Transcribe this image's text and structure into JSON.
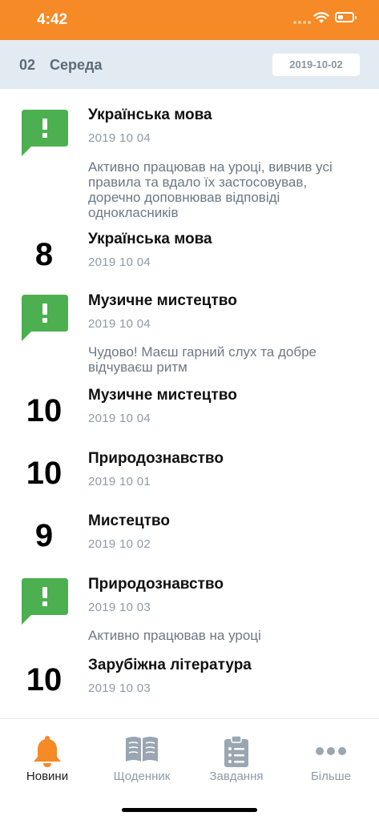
{
  "status_bar": {
    "time": "4:42",
    "background": "#f58a26"
  },
  "date_header": {
    "day_number": "02",
    "day_name": "Середа",
    "date": "2019-10-02"
  },
  "feed": {
    "items": [
      {
        "kind": "comment",
        "icon": "exclamation-bubble-icon",
        "subject": "Українська мова",
        "date": "2019 10 04",
        "comment": "Активно працював на уроці, вивчив усі правила та вдало їх застосовував, доречно доповнював відповіді однокласників"
      },
      {
        "kind": "grade",
        "grade": "8",
        "subject": "Українська мова",
        "date": "2019 10 04"
      },
      {
        "kind": "comment",
        "icon": "exclamation-bubble-icon",
        "subject": "Музичне мистецтво",
        "date": "2019 10 04",
        "comment": "Чудово! Маєш гарний слух та добре відчуваєш ритм"
      },
      {
        "kind": "grade",
        "grade": "10",
        "subject": "Музичне мистецтво",
        "date": "2019 10 04"
      },
      {
        "kind": "grade",
        "grade": "10",
        "subject": "Природознавство",
        "date": "2019 10 01"
      },
      {
        "kind": "grade",
        "grade": "9",
        "subject": "Мистецтво",
        "date": "2019 10 02"
      },
      {
        "kind": "comment",
        "icon": "exclamation-bubble-icon",
        "subject": "Природознавство",
        "date": "2019 10 03",
        "comment": "Активно працював на уроці"
      },
      {
        "kind": "grade",
        "grade": "10",
        "subject": "Зарубіжна література",
        "date": "2019 10 03"
      }
    ]
  },
  "tab_bar": {
    "active_color": "#f58a26",
    "tabs": [
      {
        "label": "Новини",
        "icon": "bell-icon",
        "active": true
      },
      {
        "label": "Щоденник",
        "icon": "book-icon",
        "active": false
      },
      {
        "label": "Завдання",
        "icon": "clipboard-list-icon",
        "active": false
      },
      {
        "label": "Більше",
        "icon": "more-dots-icon",
        "active": false
      }
    ]
  },
  "colors": {
    "comment_icon": "#4caf50",
    "header_bg": "#e3ebf2",
    "muted_text": "#8e9aa6"
  }
}
